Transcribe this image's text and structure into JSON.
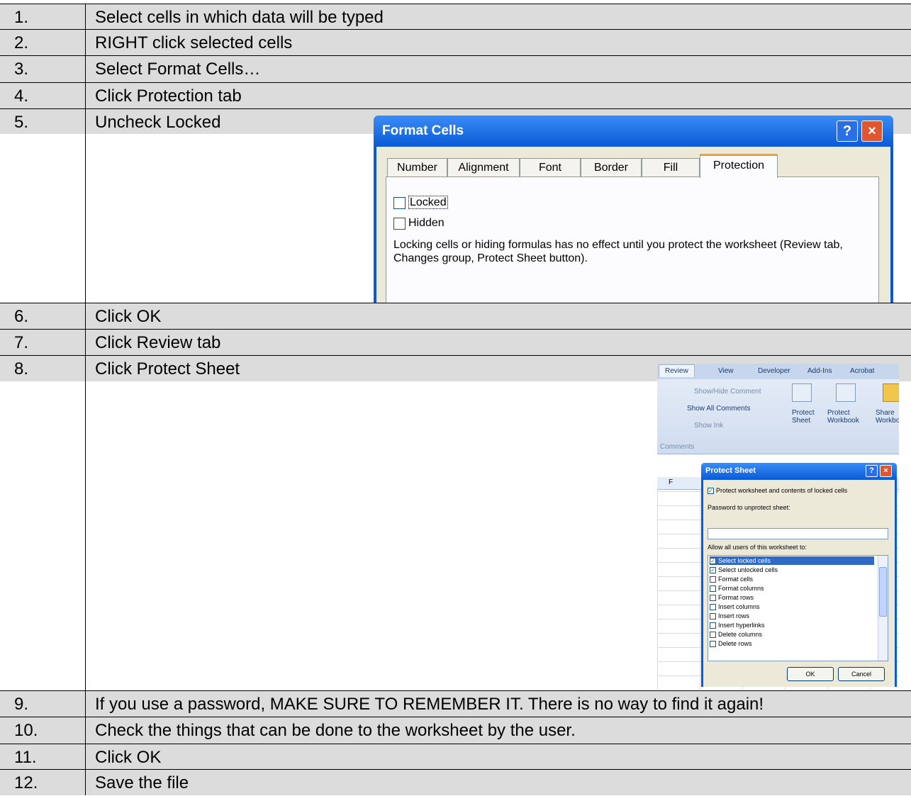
{
  "heading_fragment": "",
  "steps": [
    {
      "num": "1.",
      "text": "Select cells in which data will be typed"
    },
    {
      "num": "2.",
      "text": "RIGHT click selected cells"
    },
    {
      "num": "3.",
      "text": "Select Format Cells…"
    },
    {
      "num": "4.",
      "text": "Click Protection tab"
    },
    {
      "num": "5.",
      "text": "Uncheck Locked"
    },
    {
      "num": "6.",
      "text": "Click OK"
    },
    {
      "num": "7.",
      "text": "Click Review tab"
    },
    {
      "num": "8.",
      "text": "Click Protect Sheet"
    },
    {
      "num": "9.",
      "text": "If you use a password, MAKE SURE TO REMEMBER IT. There is no way to find it again!"
    },
    {
      "num": "10.",
      "text": "Check the things that can be done to the worksheet by the user."
    },
    {
      "num": "11.",
      "text": "Click OK"
    },
    {
      "num": "12.",
      "text": "Save the file"
    }
  ],
  "format_cells": {
    "title": "Format Cells",
    "help": "?",
    "close": "×",
    "tabs": [
      "Number",
      "Alignment",
      "Font",
      "Border",
      "Fill",
      "Protection"
    ],
    "active_tab": "Protection",
    "locked_label": "Locked",
    "locked_checked": false,
    "hidden_label": "Hidden",
    "hidden_checked": false,
    "note": "Locking cells or hiding formulas has no effect until you protect the worksheet (Review tab, Changes group, Protect Sheet button)."
  },
  "protect_sheet": {
    "ribbon_tabs": [
      "Review",
      "View",
      "Developer",
      "Add-Ins",
      "Acrobat"
    ],
    "ribbon_items": [
      "Show/Hide Comment",
      "Show All Comments",
      "Show Ink"
    ],
    "ribbon_buttons": [
      "Protect Sheet",
      "Protect Workbook",
      "Share Workbook"
    ],
    "group_label": "Comments",
    "column_letter": "F",
    "title": "Protect Sheet",
    "help": "?",
    "close": "×",
    "protect_option": "Protect worksheet and contents of locked cells",
    "password_label": "Password to unprotect sheet:",
    "allow_label": "Allow all users of this worksheet to:",
    "permissions": [
      {
        "label": "Select locked cells",
        "checked": true,
        "selected": true
      },
      {
        "label": "Select unlocked cells",
        "checked": true,
        "selected": false
      },
      {
        "label": "Format cells",
        "checked": false,
        "selected": false
      },
      {
        "label": "Format columns",
        "checked": false,
        "selected": false
      },
      {
        "label": "Format rows",
        "checked": false,
        "selected": false
      },
      {
        "label": "Insert columns",
        "checked": false,
        "selected": false
      },
      {
        "label": "Insert rows",
        "checked": false,
        "selected": false
      },
      {
        "label": "Insert hyperlinks",
        "checked": false,
        "selected": false
      },
      {
        "label": "Delete columns",
        "checked": false,
        "selected": false
      },
      {
        "label": "Delete rows",
        "checked": false,
        "selected": false
      }
    ],
    "ok": "OK",
    "cancel": "Cancel"
  }
}
